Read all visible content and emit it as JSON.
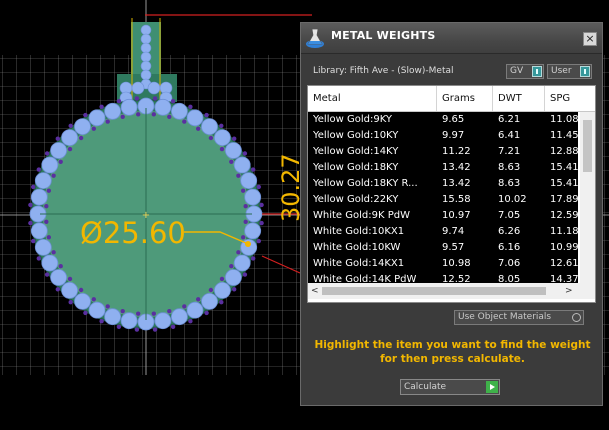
{
  "viewport": {
    "diameter_label": "Ø25.60",
    "height_label": "30.27"
  },
  "dialog": {
    "title": "METAL WEIGHTS",
    "close_label": "×",
    "library_label": "Library: Fifth Ave - (Slow)-Metal",
    "gv_label": "GV",
    "user_label": "User",
    "table": {
      "headers": [
        "Metal",
        "Grams",
        "DWT",
        "SPG"
      ],
      "rows": [
        [
          "Yellow Gold:9KY",
          "9.65",
          "6.21",
          "11.08"
        ],
        [
          "Yellow Gold:10KY",
          "9.97",
          "6.41",
          "11.45"
        ],
        [
          "Yellow Gold:14KY",
          "11.22",
          "7.21",
          "12.88"
        ],
        [
          "Yellow Gold:18KY",
          "13.42",
          "8.63",
          "15.41"
        ],
        [
          "Yellow Gold:18KY R...",
          "13.42",
          "8.63",
          "15.41"
        ],
        [
          "Yellow Gold:22KY",
          "15.58",
          "10.02",
          "17.89"
        ],
        [
          "White Gold:9K PdW",
          "10.97",
          "7.05",
          "12.59"
        ],
        [
          "White Gold:10KX1",
          "9.74",
          "6.26",
          "11.18"
        ],
        [
          "White Gold:10KW",
          "9.57",
          "6.16",
          "10.99"
        ],
        [
          "White Gold:14KX1",
          "10.98",
          "7.06",
          "12.61"
        ],
        [
          "White Gold:14K PdW",
          "12.52",
          "8.05",
          "14.37"
        ]
      ]
    },
    "scroll_left": "<",
    "scroll_right": ">",
    "use_object_materials_label": "Use Object Materials",
    "instructions": "Highlight the item you want to find the weight for then press calculate.",
    "calculate_label": "Calculate"
  },
  "colors": {
    "accent_yellow": "#f2b700",
    "pendant_fill": "#3f8f72",
    "stone_blue": "#8fb0f0",
    "prong_purple": "#5a2fa0",
    "dimension_red": "#d42020",
    "toggle_teal": "#36989b"
  }
}
